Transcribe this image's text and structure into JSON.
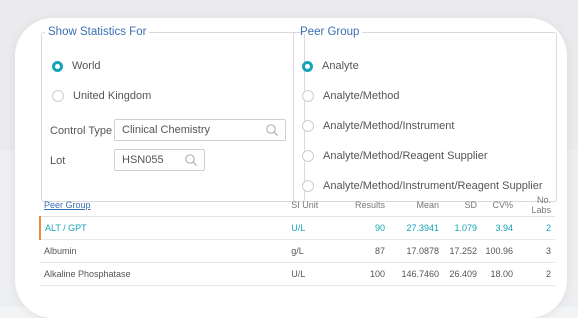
{
  "stats": {
    "legend": "Show Statistics For",
    "options": [
      {
        "label": "World",
        "selected": true
      },
      {
        "label": "United Kingdom",
        "selected": false
      }
    ],
    "control_type_label": "Control Type",
    "control_type_value": "Clinical Chemistry",
    "lot_label": "Lot",
    "lot_value": "HSN055"
  },
  "peer": {
    "legend": "Peer Group",
    "options": [
      {
        "label": "Analyte",
        "selected": true
      },
      {
        "label": "Analyte/Method",
        "selected": false
      },
      {
        "label": "Analyte/Method/Instrument",
        "selected": false
      },
      {
        "label": "Analyte/Method/Reagent Supplier",
        "selected": false
      },
      {
        "label": "Analyte/Method/Instrument/Reagent Supplier",
        "selected": false
      }
    ]
  },
  "table": {
    "headers": [
      "Peer Group",
      "SI Unit",
      "Results",
      "Mean",
      "SD",
      "CV%",
      "No. Labs"
    ],
    "rows": [
      [
        "ALT / GPT",
        "U/L",
        "90",
        "27.3941",
        "1.079",
        "3.94",
        "2"
      ],
      [
        "Albumin",
        "g/L",
        "87",
        "17.0878",
        "17.252",
        "100.96",
        "3"
      ],
      [
        "Alkaline Phosphatase",
        "U/L",
        "100",
        "146.7460",
        "26.409",
        "18.00",
        "2"
      ]
    ]
  },
  "colors": {
    "accent": "#17a3b8",
    "legend": "#3b6fb3",
    "selected_bar": "#ee8a3a"
  }
}
